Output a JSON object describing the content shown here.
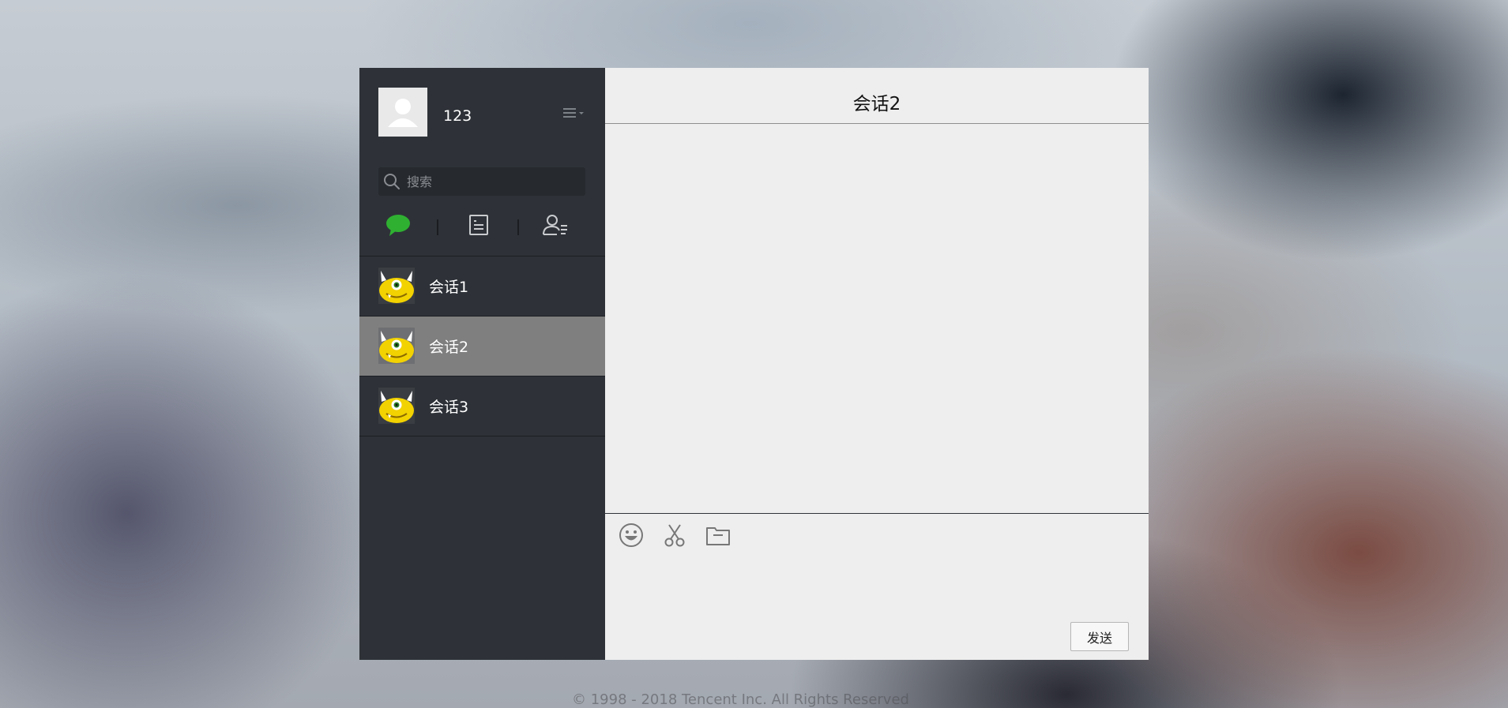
{
  "user": {
    "name": "123"
  },
  "search": {
    "placeholder": "搜索"
  },
  "tabs": [
    {
      "icon": "chat-bubble-icon",
      "active": true,
      "color": "#2fb031"
    },
    {
      "icon": "document-list-icon",
      "active": false
    },
    {
      "icon": "contacts-icon",
      "active": false
    }
  ],
  "sessions": [
    {
      "name": "会话1",
      "active": false,
      "icon": "monster-avatar"
    },
    {
      "name": "会话2",
      "active": true,
      "icon": "monster-avatar"
    },
    {
      "name": "会话3",
      "active": false,
      "icon": "monster-avatar"
    }
  ],
  "chat": {
    "title": "会话2"
  },
  "composer": {
    "tools": [
      "smiley-icon",
      "scissors-icon",
      "folder-icon"
    ],
    "send_label": "发送"
  },
  "footer": {
    "text": "© 1998 - 2018 Tencent Inc. All Rights Reserved"
  },
  "colors": {
    "sidebar_bg": "#2e3238",
    "active_session_bg": "#7f7f7f",
    "chat_bg": "#eeeeee",
    "accent_green": "#2fb031"
  }
}
